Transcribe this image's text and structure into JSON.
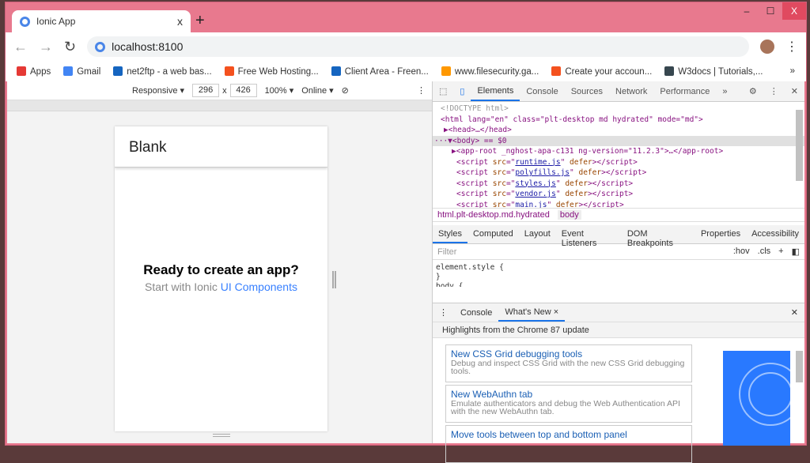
{
  "window": {
    "controls": [
      "–",
      "☐",
      "X"
    ]
  },
  "tab": {
    "title": "Ionic App",
    "close": "x",
    "new_tab": "+"
  },
  "address": {
    "url": "localhost:8100"
  },
  "bookmarks": [
    {
      "label": "Apps",
      "color": "#e53935"
    },
    {
      "label": "Gmail",
      "color": "#4285f4"
    },
    {
      "label": "net2ftp - a web bas...",
      "color": "#1565c0"
    },
    {
      "label": "Free Web Hosting...",
      "color": "#f4511e"
    },
    {
      "label": "Client Area - Freen...",
      "color": "#1565c0"
    },
    {
      "label": "www.filesecurity.ga...",
      "color": "#ff9800"
    },
    {
      "label": "Create your accoun...",
      "color": "#f4511e"
    },
    {
      "label": "W3docs | Tutorials,...",
      "color": "#37474f"
    }
  ],
  "bookmarks_more": "»",
  "device_bar": {
    "mode": "Responsive ▾",
    "width": "296",
    "x": "x",
    "height": "426",
    "zoom": "100% ▾",
    "network": "Online ▾"
  },
  "app": {
    "header": "Blank",
    "heading": "Ready to create an app?",
    "sub_prefix": "Start with Ionic",
    "sub_link": "UI Components"
  },
  "devtools": {
    "tabs": [
      "Elements",
      "Console",
      "Sources",
      "Network",
      "Performance",
      "»"
    ],
    "code": {
      "doctype": "<!DOCTYPE html>",
      "html_open": "<html lang=\"en\" class=\"plt-desktop md hydrated\" mode=\"md\">",
      "head": "▶<head>…</head>",
      "body": "···▼<body> == $0",
      "app_root": "▶<app-root _nghost-apa-c131 ng-version=\"11.2.3\">…</app-root>",
      "scripts": [
        "runtime.js",
        "polyfills.js",
        "styles.js",
        "vendor.js",
        "main.js"
      ]
    },
    "crumbs": [
      "html.plt-desktop.md.hydrated",
      "body"
    ],
    "style_tabs": [
      "Styles",
      "Computed",
      "Layout",
      "Event Listeners",
      "DOM Breakpoints",
      "Properties",
      "Accessibility"
    ],
    "filter_placeholder": "Filter",
    "hov": ":hov",
    "cls": ".cls",
    "add": "+",
    "rules": [
      "element.style {",
      "}",
      "body {"
    ],
    "drawer_tabs": [
      "Console",
      "What's New ×"
    ],
    "highlights": "Highlights from the Chrome 87 update",
    "cards": [
      {
        "title": "New CSS Grid debugging tools",
        "desc": "Debug and inspect CSS Grid with the new CSS Grid debugging tools."
      },
      {
        "title": "New WebAuthn tab",
        "desc": "Emulate authenticators and debug the Web Authentication API with the new WebAuthn tab."
      },
      {
        "title": "Move tools between top and bottom panel",
        "desc": ""
      }
    ]
  }
}
